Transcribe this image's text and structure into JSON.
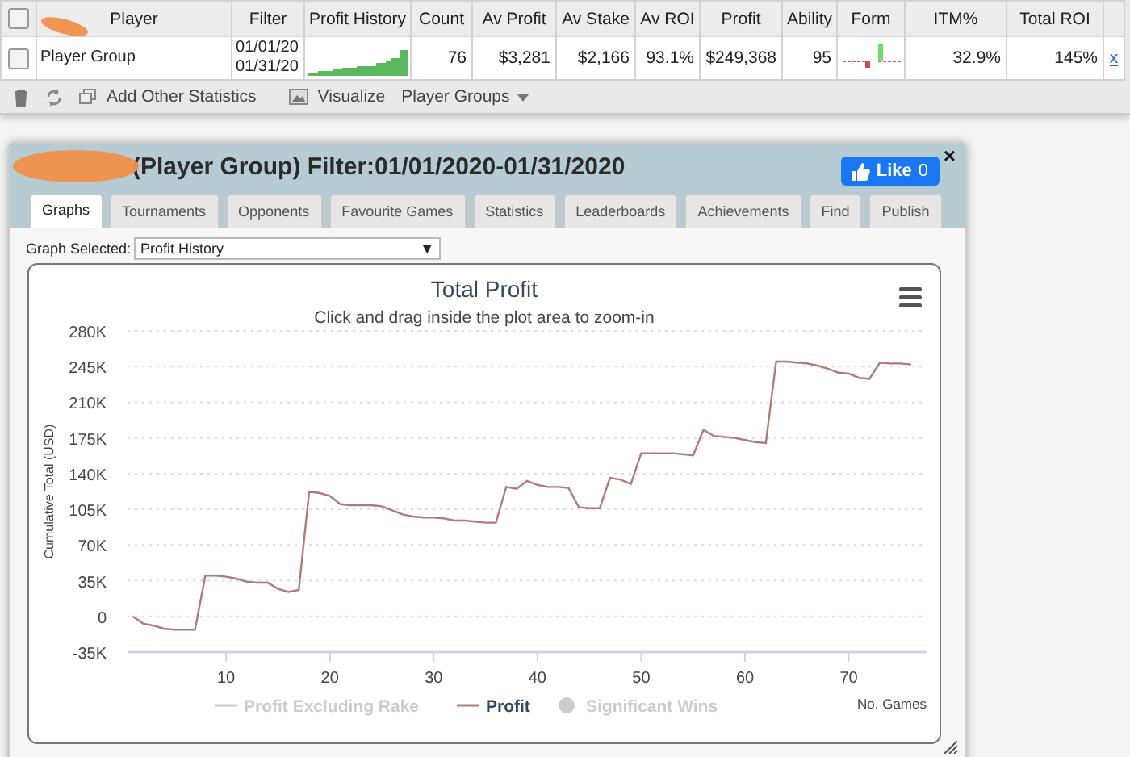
{
  "stats_table": {
    "all_selected": false,
    "columns": [
      "Player",
      "Filter",
      "Profit History",
      "Count",
      "Av Profit",
      "Av Stake",
      "Av ROI",
      "Profit",
      "Ability",
      "Form",
      "ITM%",
      "Total ROI"
    ],
    "rows": [
      {
        "selected": false,
        "player": "Player Group",
        "filter": [
          "01/01/20",
          "01/31/20"
        ],
        "count": "76",
        "av_profit": "$3,281",
        "av_stake": "$2,166",
        "av_roi": "93.1%",
        "profit": "$249,368",
        "ability": "95",
        "itm": "32.9%",
        "total_roi": "145%",
        "remove": "x"
      }
    ]
  },
  "toolbar": {
    "items": [
      "Add Other Statistics",
      "Visualize",
      "Player Groups"
    ]
  },
  "dialog": {
    "title": "(Player Group) Filter:01/01/2020-01/31/2020",
    "like": {
      "label": "Like",
      "count": "0"
    },
    "close": "×",
    "tabs": [
      {
        "label": "Graphs",
        "selected": true
      },
      {
        "label": "Tournaments",
        "selected": false
      },
      {
        "label": "Opponents",
        "selected": false
      },
      {
        "label": "Favourite Games",
        "selected": false
      },
      {
        "label": "Statistics",
        "selected": false
      },
      {
        "label": "Leaderboards",
        "selected": false
      },
      {
        "label": "Achievements",
        "selected": false
      },
      {
        "label": "Find",
        "selected": false
      },
      {
        "label": "Publish",
        "selected": false
      }
    ],
    "graph_select": {
      "label": "Graph Selected:",
      "value": "Profit History",
      "arrow": "▼"
    },
    "graph": {
      "subtitle": "Click and drag inside the plot area to zoom-in",
      "legend": [
        {
          "label": "Profit Excluding Rake",
          "kind": "line",
          "active": false
        },
        {
          "kind": "series",
          "active": true
        },
        {
          "label": "Significant Wins",
          "kind": "dot",
          "active": false
        }
      ],
      "chart_data": {
        "type": "line",
        "grid": true,
        "title": "Total Profit",
        "xlabel": "No. Games",
        "ylabel": "Cumulative Total (USD)",
        "xlim": [
          0.5,
          77.5
        ],
        "ylim": [
          -35000,
          280000
        ],
        "xticks": [
          10,
          20,
          30,
          40,
          50,
          60,
          70
        ],
        "yticks": [
          {
            "value": -35000,
            "label": "-35K"
          },
          {
            "value": 0,
            "label": "0"
          },
          {
            "value": 35000,
            "label": "35K"
          },
          {
            "value": 70000,
            "label": "70K"
          },
          {
            "value": 105000,
            "label": "105K"
          },
          {
            "value": 140000,
            "label": "140K"
          },
          {
            "value": 175000,
            "label": "175K"
          },
          {
            "value": 210000,
            "label": "210K"
          },
          {
            "value": 245000,
            "label": "245K"
          },
          {
            "value": 280000,
            "label": "280K"
          }
        ],
        "x": [
          1,
          2,
          3,
          4,
          5,
          6,
          7,
          8,
          9,
          10,
          11,
          12,
          13,
          14,
          15,
          16,
          17,
          18,
          19,
          20,
          21,
          22,
          23,
          24,
          25,
          26,
          27,
          28,
          29,
          30,
          31,
          32,
          33,
          34,
          35,
          36,
          37,
          38,
          39,
          40,
          41,
          42,
          43,
          44,
          45,
          46,
          47,
          48,
          49,
          50,
          51,
          52,
          53,
          54,
          55,
          56,
          57,
          58,
          59,
          60,
          61,
          62,
          63,
          64,
          65,
          66,
          67,
          68,
          69,
          70,
          71,
          72,
          73,
          74,
          75,
          76
        ],
        "series": [
          {
            "name": "Profit",
            "color": "#b07a78",
            "values": [
              0,
              -7000,
              -9000,
              -12000,
              -13000,
              -13000,
              -13000,
              40000,
              40000,
              39000,
              37000,
              34000,
              33000,
              33000,
              27000,
              24000,
              26000,
              122000,
              121000,
              118000,
              110000,
              109000,
              109000,
              109000,
              108000,
              104000,
              100000,
              98000,
              97000,
              97000,
              96000,
              94000,
              94000,
              93000,
              92000,
              92000,
              127000,
              125000,
              133000,
              129000,
              127000,
              127000,
              126000,
              107000,
              106000,
              106000,
              136000,
              134000,
              130000,
              160000,
              160000,
              160000,
              160000,
              159000,
              158000,
              183000,
              177000,
              176000,
              175000,
              173000,
              171000,
              170000,
              250000,
              250000,
              249000,
              248000,
              246000,
              243000,
              239000,
              238000,
              234000,
              233000,
              249000,
              248000,
              248000,
              247000
            ]
          }
        ]
      }
    }
  }
}
